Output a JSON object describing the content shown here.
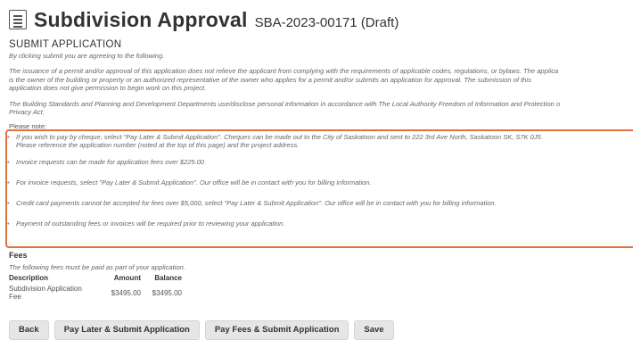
{
  "header": {
    "icon": "document-icon",
    "title": "Subdivision Approval",
    "reference": "SBA-2023-00171 (Draft)"
  },
  "submit": {
    "heading": "SUBMIT APPLICATION",
    "agree_text": "By clicking submit you are agreeing to the following.",
    "disclaimer_lines": [
      "The issuance of a permit and/or approval of this application does not relieve the applicant from complying with the requirements of applicable codes, regulations, or bylaws. The applica",
      "is the owner of the building or property or an authorized representative of the owner who applies for a permit and/or submits an application for approval. The submission of this",
      "application does not give permission to begin work on this project."
    ],
    "privacy_lines": [
      "The Building Standards and Planning and Development Departments use/disclose personal information in accordance with The Local Authority Freedom of Information and Protection o",
      "Privacy Act."
    ],
    "please_note": "Please note:",
    "notes": [
      {
        "lines": [
          "If you wish to pay by cheque, select \"Pay Later & Submit Application\". Cheques can be made out to the City of Saskatoon and sent to 222 3rd Ave North, Saskatoon SK, S7K 0J5.",
          "Please reference the application number (noted at the top of this page) and the project address."
        ]
      },
      {
        "lines": [
          "Invoice requests can be made for application fees over $225.00"
        ]
      },
      {
        "lines": [
          "For invoice requests, select \"Pay Later & Submit Application\". Our office will be in contact with you for billing information."
        ]
      },
      {
        "lines": [
          "Credit card payments cannot be accepted for fees over $5,000, select \"Pay Later & Submit Application\". Our office will be in contact with you for billing information."
        ]
      },
      {
        "lines": [
          "Payment of outstanding fees or invoices will be required prior to reviewing your application."
        ]
      }
    ],
    "highlight_color": "#e4703c"
  },
  "fees": {
    "heading": "Fees",
    "note": "The following fees must be paid as part of your application.",
    "columns": [
      "Description",
      "Amount",
      "Balance"
    ],
    "rows": [
      {
        "description_lines": [
          "Subdivision Application",
          "Fee"
        ],
        "amount": "$3495.00",
        "balance": "$3495.00"
      }
    ]
  },
  "actions": {
    "back": "Back",
    "pay_later": "Pay Later & Submit Application",
    "pay_fees": "Pay Fees & Submit Application",
    "save": "Save"
  }
}
